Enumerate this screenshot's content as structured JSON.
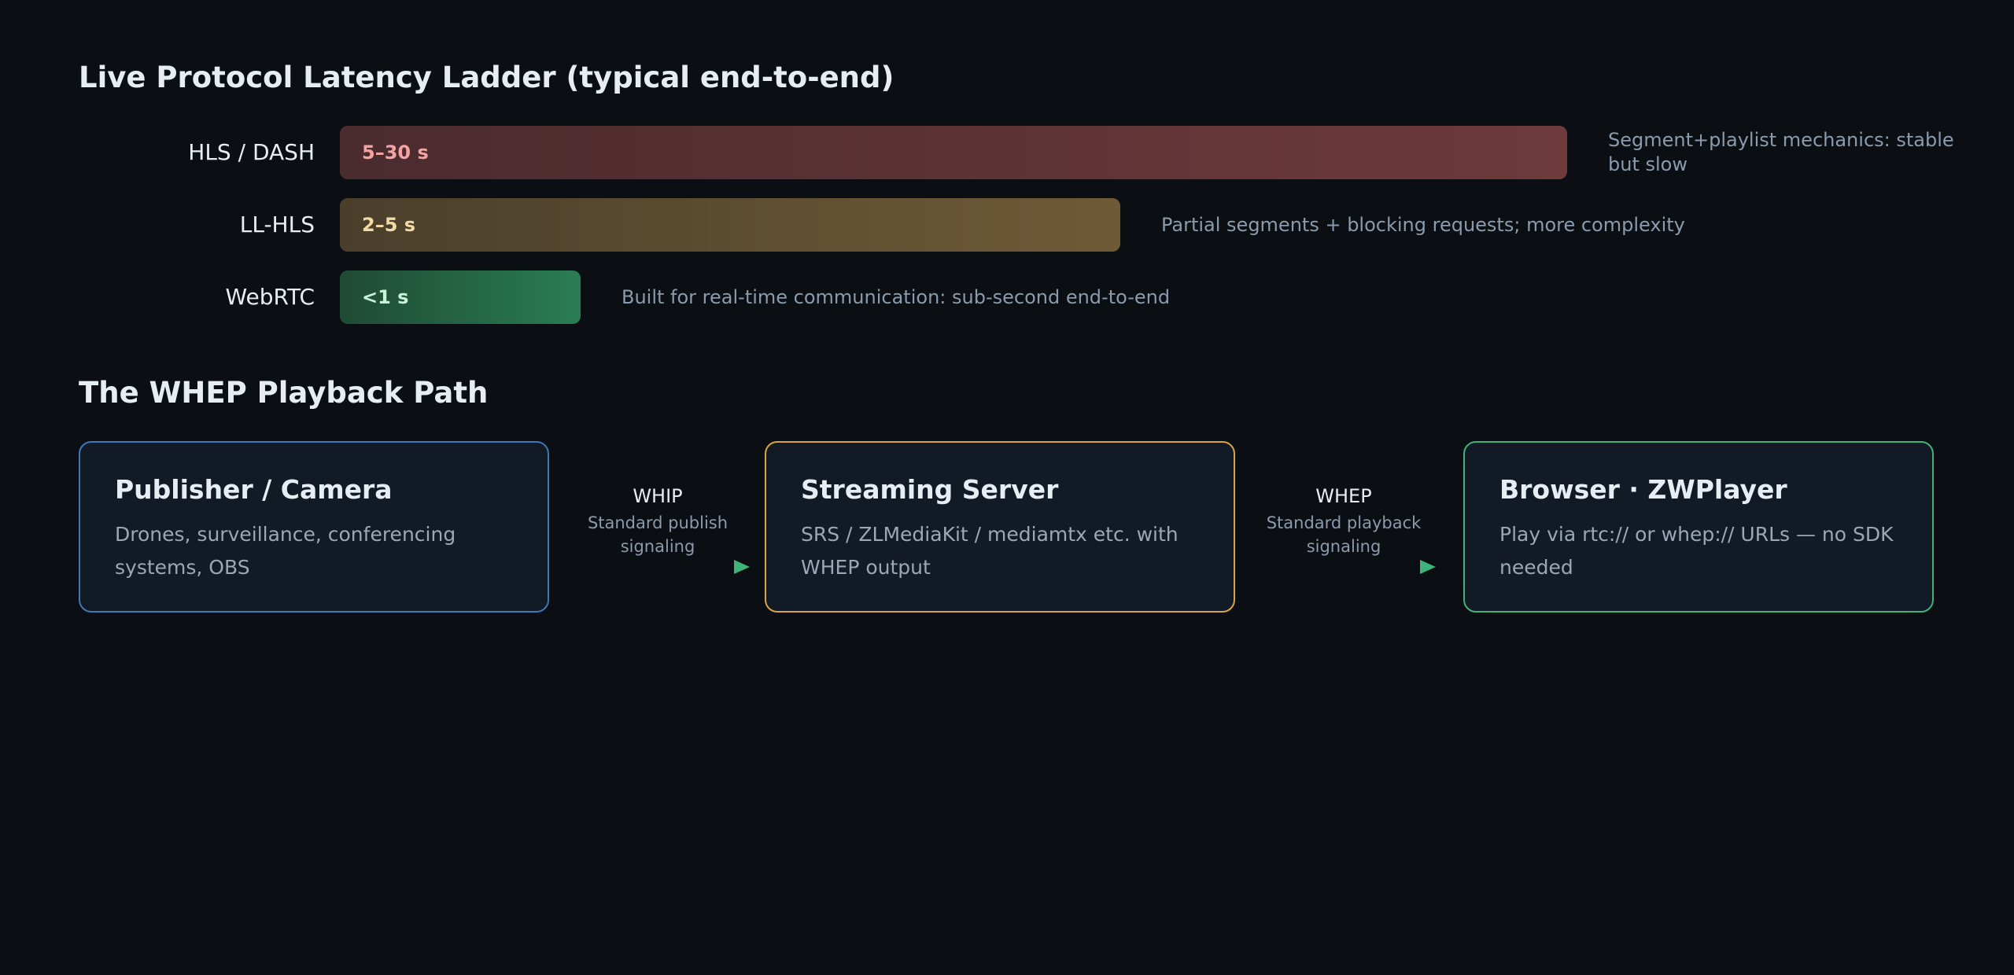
{
  "ladder": {
    "title": "Live Protocol Latency Ladder (typical end-to-end)",
    "rows": [
      {
        "protocol": "HLS / DASH",
        "range": "5–30 s",
        "note": "Segment+playlist mechanics: stable but slow",
        "text_color": "#f4a3a3",
        "from": "#4a2b2e",
        "to": "#6e3a3c"
      },
      {
        "protocol": "LL-HLS",
        "range": "2–5 s",
        "note": "Partial segments + blocking requests; more complexity",
        "text_color": "#f3d9a6",
        "from": "#4a3f2b",
        "to": "#6f5a37"
      },
      {
        "protocol": "WebRTC",
        "range": "<1 s",
        "note": "Built for real-time communication: sub-second end-to-end",
        "text_color": "#c9f2d8",
        "from": "#1f4a34",
        "to": "#2a7d54"
      }
    ]
  },
  "path": {
    "title": "The WHEP Playback Path",
    "nodes": [
      {
        "title": "Publisher / Camera",
        "desc": "Drones, surveillance, conferencing systems, OBS",
        "border": "#3f78b5"
      },
      {
        "title": "Streaming Server",
        "desc": "SRS / ZLMediaKit / mediamtx etc. with WHEP output",
        "border": "#d9a441"
      },
      {
        "title": "Browser · ZWPlayer",
        "desc": "Play via rtc:// or whep:// URLs — no SDK needed",
        "border": "#3fb37a"
      }
    ],
    "links": [
      {
        "name": "WHIP",
        "sub": "Standard publish signaling"
      },
      {
        "name": "WHEP",
        "sub": "Standard playback signaling"
      }
    ],
    "arrow_colors": {
      "start": "#3f78b5",
      "end": "#3fb37a"
    }
  }
}
